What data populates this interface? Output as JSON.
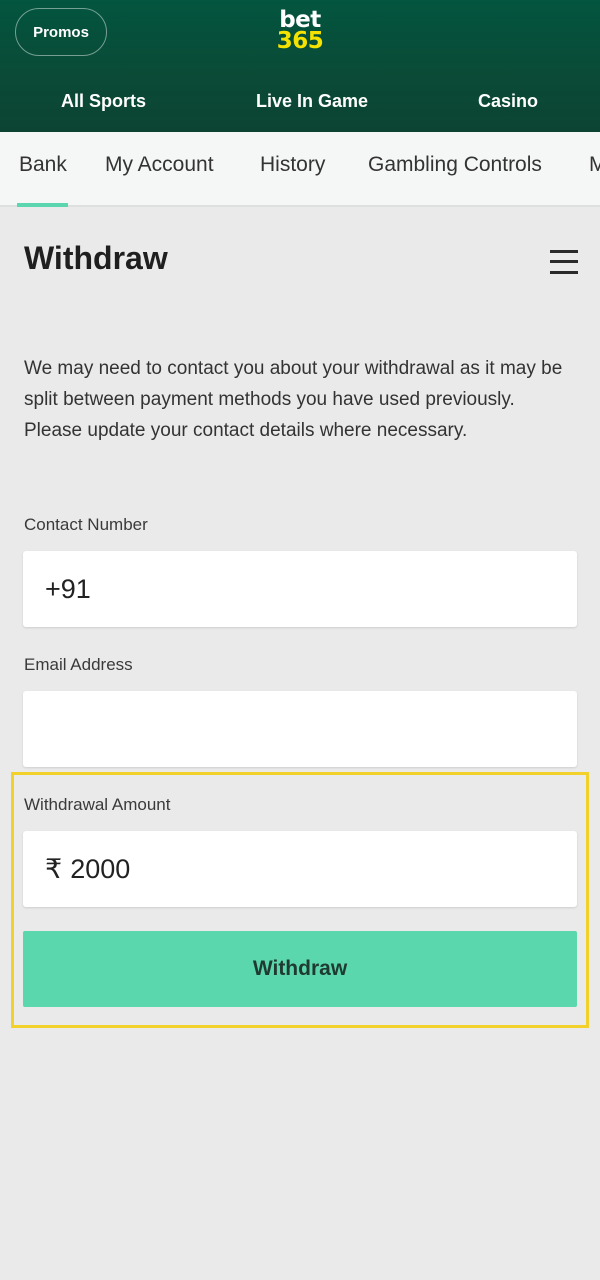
{
  "header": {
    "promos_label": "Promos",
    "logo_line1": "bet",
    "logo_line2": "365",
    "nav": [
      {
        "label": "All Sports"
      },
      {
        "label": "Live In Game"
      },
      {
        "label": "Casino"
      }
    ]
  },
  "subnav": {
    "items": [
      {
        "label": "Bank",
        "active": true
      },
      {
        "label": "My Account"
      },
      {
        "label": "History"
      },
      {
        "label": "Gambling Controls"
      },
      {
        "label": "M"
      }
    ]
  },
  "page": {
    "title": "Withdraw",
    "intro": "We may need to contact you about your withdrawal as it may be split between payment methods you have used previously. Please update your contact details where necessary."
  },
  "form": {
    "contact_label": "Contact Number",
    "contact_value": "+91",
    "email_label": "Email Address",
    "email_value": "",
    "amount_label": "Withdrawal Amount",
    "currency_symbol": "₹",
    "amount_value": "2000",
    "submit_label": "Withdraw"
  },
  "colors": {
    "header_green": "#03553f",
    "accent_green": "#5ad7ac",
    "logo_yellow": "#f6e200",
    "highlight_yellow": "#f2d22a"
  },
  "icons": {
    "menu": "hamburger-menu-icon"
  }
}
